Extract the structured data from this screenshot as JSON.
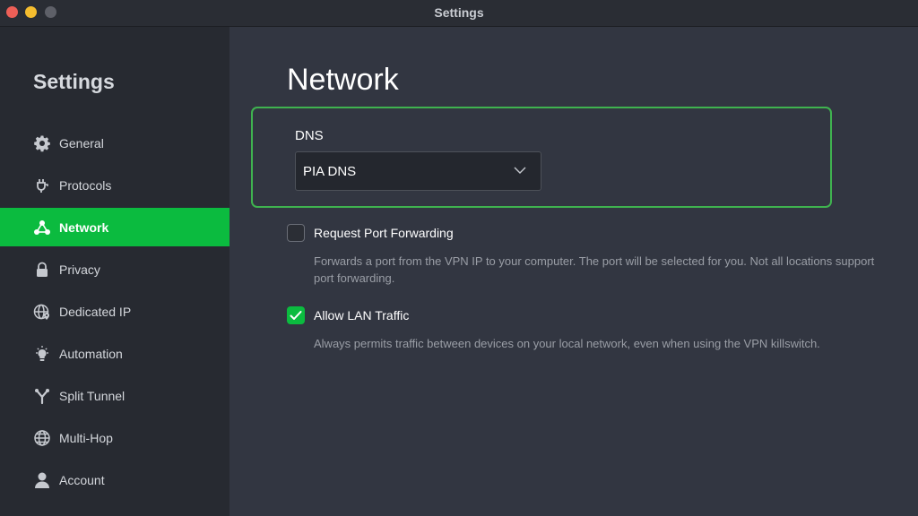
{
  "window": {
    "title": "Settings",
    "traffic_lights": [
      "close",
      "minimize",
      "maximize"
    ]
  },
  "sidebar": {
    "title": "Settings",
    "active_item": "Network",
    "items": [
      {
        "label": "General",
        "icon": "gear-icon"
      },
      {
        "label": "Protocols",
        "icon": "plug-icon"
      },
      {
        "label": "Network",
        "icon": "network-icon"
      },
      {
        "label": "Privacy",
        "icon": "lock-icon"
      },
      {
        "label": "Dedicated IP",
        "icon": "globe-pin-icon"
      },
      {
        "label": "Automation",
        "icon": "lightbulb-icon"
      },
      {
        "label": "Split Tunnel",
        "icon": "split-icon"
      },
      {
        "label": "Multi-Hop",
        "icon": "globe-icon"
      },
      {
        "label": "Account",
        "icon": "user-icon"
      }
    ]
  },
  "main": {
    "title": "Network",
    "dns": {
      "label": "DNS",
      "selected": "PIA DNS"
    },
    "options": [
      {
        "label": "Request Port Forwarding",
        "checked": false,
        "description": "Forwards a port from the VPN IP to your computer. The port will be selected for you. Not all locations support port forwarding."
      },
      {
        "label": "Allow LAN Traffic",
        "checked": true,
        "description": "Always permits traffic between devices on your local network, even when using the VPN killswitch."
      }
    ]
  },
  "colors": {
    "accent": "#0bbb3f",
    "highlight_border": "#3fb34f",
    "sidebar_bg": "#272a31",
    "main_bg": "#323641"
  }
}
